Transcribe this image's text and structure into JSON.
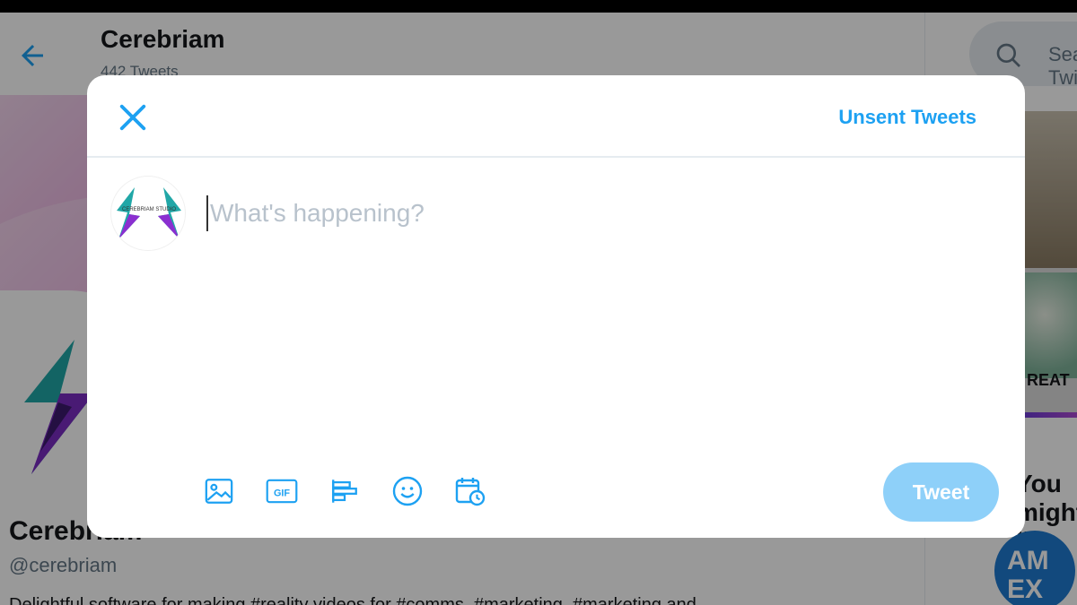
{
  "background": {
    "header": {
      "title": "Cerebriam",
      "count": "442 Tweets"
    },
    "profile": {
      "name": "Cerebriam",
      "handle": "@cerebriam",
      "bio": "Delightful software for making #reality videos for #comms, #marketing, #marketing and"
    },
    "sidebar": {
      "search_placeholder": "Search Twitter",
      "trend_caption": "REAT",
      "who_to_follow": "You might like",
      "promo_logo": "AM EX"
    }
  },
  "modal": {
    "unsent_label": "Unsent Tweets",
    "placeholder": "What's happening?",
    "tweet_label": "Tweet",
    "gif_label": "GIF",
    "avatar_text": "CEREBRIAM STUDIO",
    "accent_color": "#1da1f2",
    "tools": [
      "image-icon",
      "gif-icon",
      "poll-icon",
      "emoji-icon",
      "schedule-icon"
    ]
  }
}
